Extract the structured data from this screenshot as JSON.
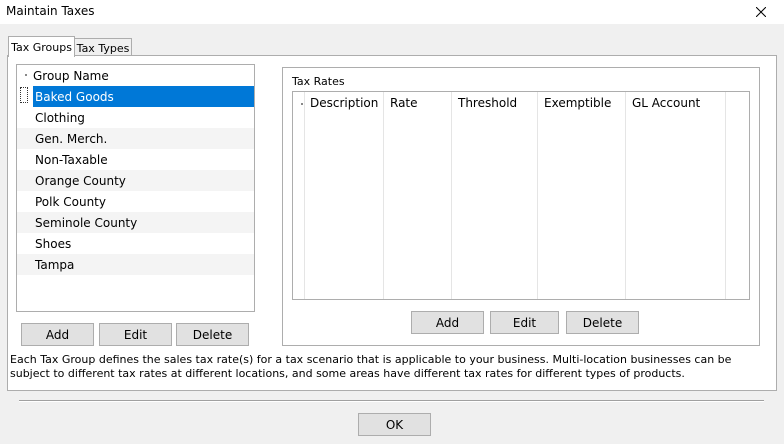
{
  "window": {
    "title": "Maintain Taxes"
  },
  "tabs": [
    {
      "label": "Tax Groups",
      "active": true
    },
    {
      "label": "Tax Types",
      "active": false
    }
  ],
  "group_list": {
    "header": "Group Name",
    "items": [
      {
        "label": "Baked Goods",
        "selected": true
      },
      {
        "label": "Clothing"
      },
      {
        "label": "Gen. Merch."
      },
      {
        "label": "Non-Taxable"
      },
      {
        "label": "Orange County"
      },
      {
        "label": "Polk County"
      },
      {
        "label": "Seminole County"
      },
      {
        "label": "Shoes"
      },
      {
        "label": "Tampa"
      }
    ]
  },
  "group_buttons": {
    "add": "Add",
    "edit": "Edit",
    "delete": "Delete"
  },
  "tax_rates": {
    "label": "Tax Rates",
    "columns": [
      "Description",
      "Rate",
      "Threshold",
      "Exemptible",
      "GL Account"
    ]
  },
  "rate_buttons": {
    "add": "Add",
    "edit": "Edit",
    "delete": "Delete"
  },
  "description": "Each Tax Group defines the sales tax rate(s) for a tax scenario that is applicable to your business. Multi-location businesses can be subject to different tax rates at different locations, and some areas have different tax rates for different types of products.",
  "footer": {
    "ok": "OK"
  },
  "colors": {
    "selection": "#0078d7",
    "border": "#adadad",
    "button_face": "#e1e1e1"
  }
}
